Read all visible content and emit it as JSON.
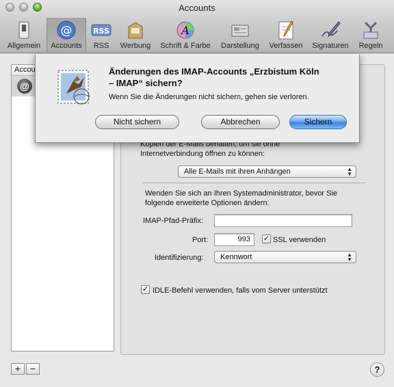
{
  "window": {
    "title": "Accounts"
  },
  "toolbar": {
    "items": [
      {
        "label": "Allgemein",
        "icon": "switch-icon"
      },
      {
        "label": "Accounts",
        "icon": "at-sign-icon",
        "selected": true
      },
      {
        "label": "RSS",
        "icon": "rss-icon"
      },
      {
        "label": "Werbung",
        "icon": "junk-mail-icon"
      },
      {
        "label": "Schrift & Farbe",
        "icon": "font-color-icon"
      },
      {
        "label": "Darstellung",
        "icon": "viewing-icon"
      },
      {
        "label": "Verfassen",
        "icon": "compose-icon"
      },
      {
        "label": "Signaturen",
        "icon": "signature-icon"
      },
      {
        "label": "Regeln",
        "icon": "rules-icon"
      }
    ]
  },
  "accounts": {
    "header": "Accounts",
    "add_label": "+",
    "remove_label": "−"
  },
  "panel": {
    "keep_copies_text_1": "Kopien der E-Mails behalten, um sie ohne",
    "keep_copies_text_2": "Internetverbindung öffnen zu können:",
    "keep_copies_value": "Alle E-Mails mit ihren Anhängen",
    "admin_note_1": "Wenden Sie sich an Ihren Systemadministrator, bevor Sie",
    "admin_note_2": "folgende erweiterte Optionen ändern:",
    "imap_prefix_label": "IMAP-Pfad-Präfix:",
    "imap_prefix_value": "",
    "port_label": "Port:",
    "port_value": "993",
    "ssl_label": "SSL verwenden",
    "ssl_checked": true,
    "auth_label": "Identifizierung:",
    "auth_value": "Kennwort",
    "idle_label": "IDLE-Befehl verwenden, falls vom Server unterstützt",
    "idle_checked": true
  },
  "dialog": {
    "title_line_1": "Änderungen des IMAP-Accounts „Erzbistum Köln",
    "title_line_2": "– IMAP“ sichern?",
    "message": "Wenn Sie die Änderungen nicht sichern, gehen sie verloren.",
    "dont_save_label": "Nicht sichern",
    "cancel_label": "Abbrechen",
    "save_label": "Sichern"
  },
  "help": {
    "label": "?"
  },
  "colors": {
    "default_button": "#3b86e0",
    "toolbar_selected": "#a8a8a8"
  }
}
